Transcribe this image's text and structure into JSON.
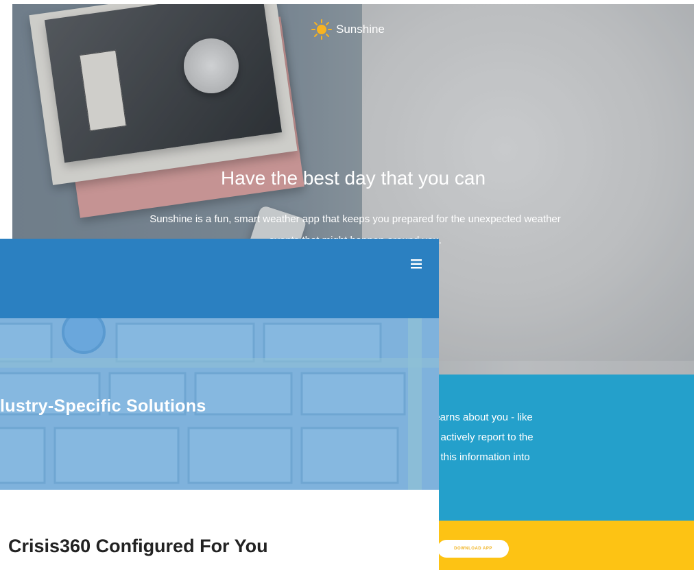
{
  "sunshine": {
    "brand_name": "Sunshine",
    "hero_title": "Have the best day that you can",
    "hero_description": "Sunshine is a fun, smart weather app that keeps you prepared for the unexpected weather events that might happen around you.",
    "feature_lines": [
      "learns about you - like",
      "u actively report to the",
      "g this information into"
    ],
    "download_label": "DOWNLOAD APP",
    "colors": {
      "blue_band": "#24a0cb",
      "yellow_band": "#fdc314",
      "sun": "#f7b321"
    }
  },
  "crisis": {
    "banner_title": "lustry-Specific Solutions",
    "section_heading": "Crisis360 Configured For You",
    "menu_icon": "hamburger-menu-icon",
    "colors": {
      "nav": "#2b80c1",
      "banner": "#7fb2dc"
    }
  }
}
